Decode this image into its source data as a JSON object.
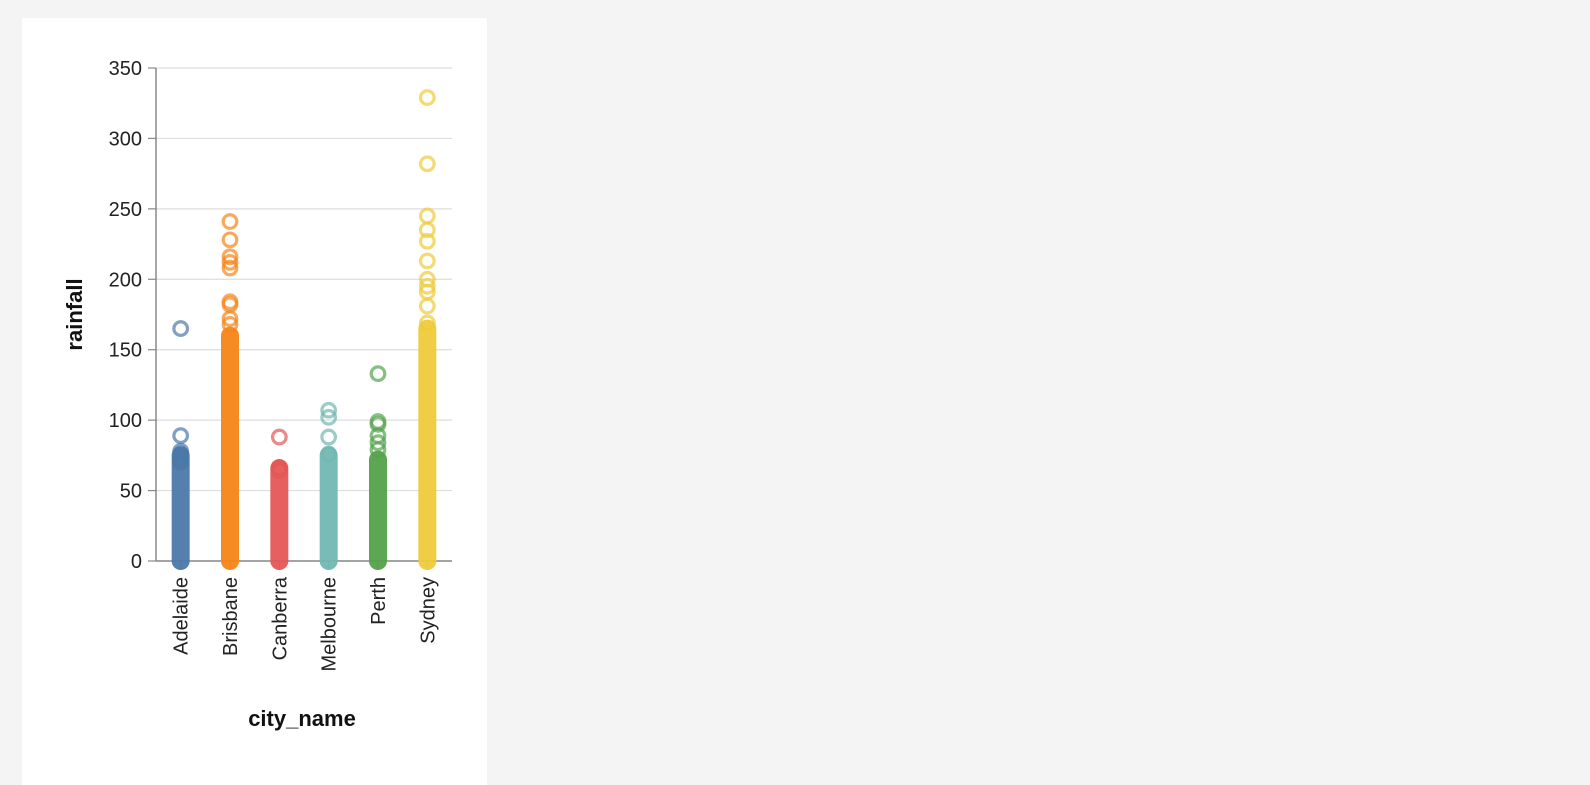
{
  "chart_data": {
    "type": "scatter",
    "xlabel": "city_name",
    "ylabel": "rainfall",
    "ylim": [
      0,
      350
    ],
    "yticks": [
      0,
      50,
      100,
      150,
      200,
      250,
      300,
      350
    ],
    "grid": true,
    "categories": [
      "Adelaide",
      "Brisbane",
      "Canberra",
      "Melbourne",
      "Perth",
      "Sydney"
    ],
    "series": [
      {
        "category": "Adelaide",
        "color": "#4c78a8",
        "max_dense": 75,
        "points": [
          165,
          89,
          78,
          76,
          74,
          72,
          70
        ]
      },
      {
        "category": "Brisbane",
        "color": "#f58518",
        "max_dense": 160,
        "points": [
          241,
          228,
          216,
          212,
          208,
          184,
          182,
          172,
          168
        ]
      },
      {
        "category": "Canberra",
        "color": "#e45756",
        "max_dense": 66,
        "points": [
          88,
          66,
          64
        ]
      },
      {
        "category": "Melbourne",
        "color": "#72b7b2",
        "max_dense": 75,
        "points": [
          107,
          102,
          88,
          76
        ]
      },
      {
        "category": "Perth",
        "color": "#54a24b",
        "max_dense": 72,
        "points": [
          133,
          99,
          97,
          89,
          84,
          79
        ]
      },
      {
        "category": "Sydney",
        "color": "#eeca3b",
        "max_dense": 165,
        "points": [
          329,
          282,
          245,
          235,
          227,
          213,
          200,
          195,
          191,
          181,
          169
        ]
      }
    ]
  }
}
